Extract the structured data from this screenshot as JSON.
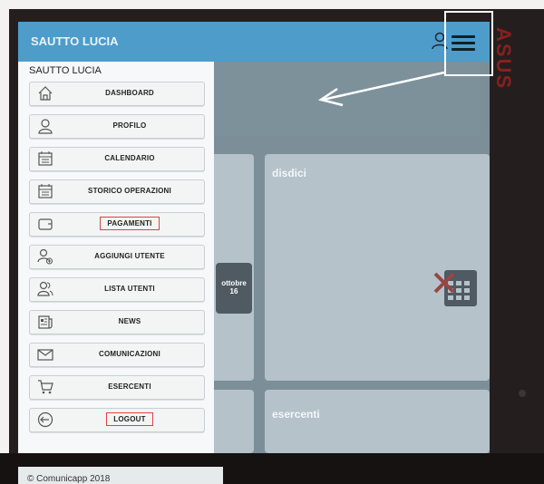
{
  "app": {
    "title": "SAUTTO LUCIA",
    "footer": "© Comunicapp 2018"
  },
  "sidebar": {
    "user_name": "SAUTTO LUCIA",
    "items": [
      {
        "label": "DASHBOARD",
        "icon": "home-icon"
      },
      {
        "label": "PROFILO",
        "icon": "user-icon"
      },
      {
        "label": "CALENDARIO",
        "icon": "calendar-icon"
      },
      {
        "label": "STORICO OPERAZIONI",
        "icon": "calendar-icon"
      },
      {
        "label": "PAGAMENTI",
        "icon": "wallet-icon",
        "highlighted": true
      },
      {
        "label": "AGGIUNGI UTENTE",
        "icon": "add-user-icon"
      },
      {
        "label": "LISTA UTENTI",
        "icon": "users-icon"
      },
      {
        "label": "NEWS",
        "icon": "newspaper-icon"
      },
      {
        "label": "COMUNICAZIONI",
        "icon": "envelope-icon"
      },
      {
        "label": "ESERCENTI",
        "icon": "cart-icon"
      },
      {
        "label": "LOGOUT",
        "icon": "logout-icon",
        "highlighted": true
      }
    ]
  },
  "tiles": {
    "disdici": "disdici",
    "esercenti": "esercenti",
    "calendar_month": "ottobre",
    "calendar_day": "16"
  },
  "colors": {
    "appbar": "#4d9cca",
    "highlight_border": "#e04040",
    "annotation": "#ffffff"
  }
}
